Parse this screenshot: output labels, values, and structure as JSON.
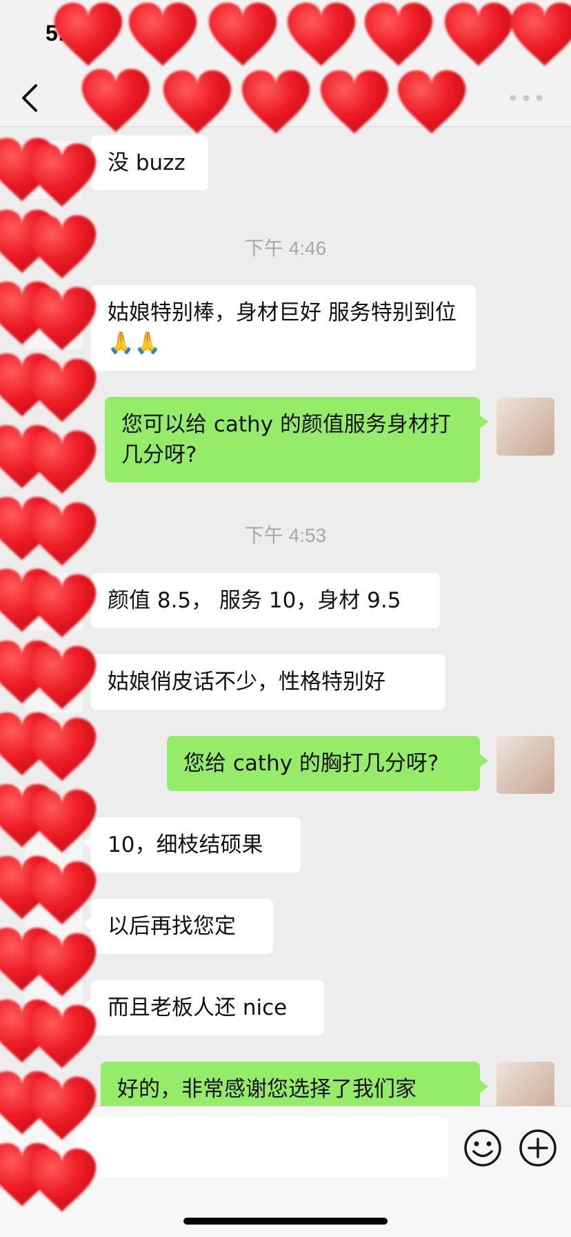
{
  "status_bar": {
    "time": "5:0"
  },
  "messages": [
    {
      "side": "in",
      "text": "没 buzz"
    },
    {
      "type": "time",
      "text": "下午 4:46"
    },
    {
      "side": "in",
      "text": "姑娘特别棒，身材巨好 服务特别到位🙏🙏"
    },
    {
      "side": "out",
      "text": "您可以给 cathy 的颜值服务身材打几分呀?"
    },
    {
      "type": "time",
      "text": "下午 4:53"
    },
    {
      "side": "in",
      "text": "颜值 8.5， 服务 10，身材 9.5"
    },
    {
      "side": "in",
      "text": "姑娘俏皮话不少，性格特别好"
    },
    {
      "side": "out",
      "text": "您给 cathy 的胸打几分呀?"
    },
    {
      "side": "in",
      "text": "10，细枝结硕果"
    },
    {
      "side": "in",
      "text": "以后再找您定"
    },
    {
      "side": "in",
      "text": "而且老板人还 nice"
    },
    {
      "side": "out",
      "text": "好的，非常感谢您选择了我们家"
    }
  ],
  "colors": {
    "outgoing_bubble": "#95ec69",
    "incoming_bubble": "#ffffff",
    "chat_background": "#ededed",
    "heart_overlay": "#ee1c25"
  },
  "icons": {
    "back": "chevron-left-icon",
    "more": "more-dots-icon",
    "emoji": "smiley-face-icon",
    "plus": "plus-circle-icon"
  }
}
